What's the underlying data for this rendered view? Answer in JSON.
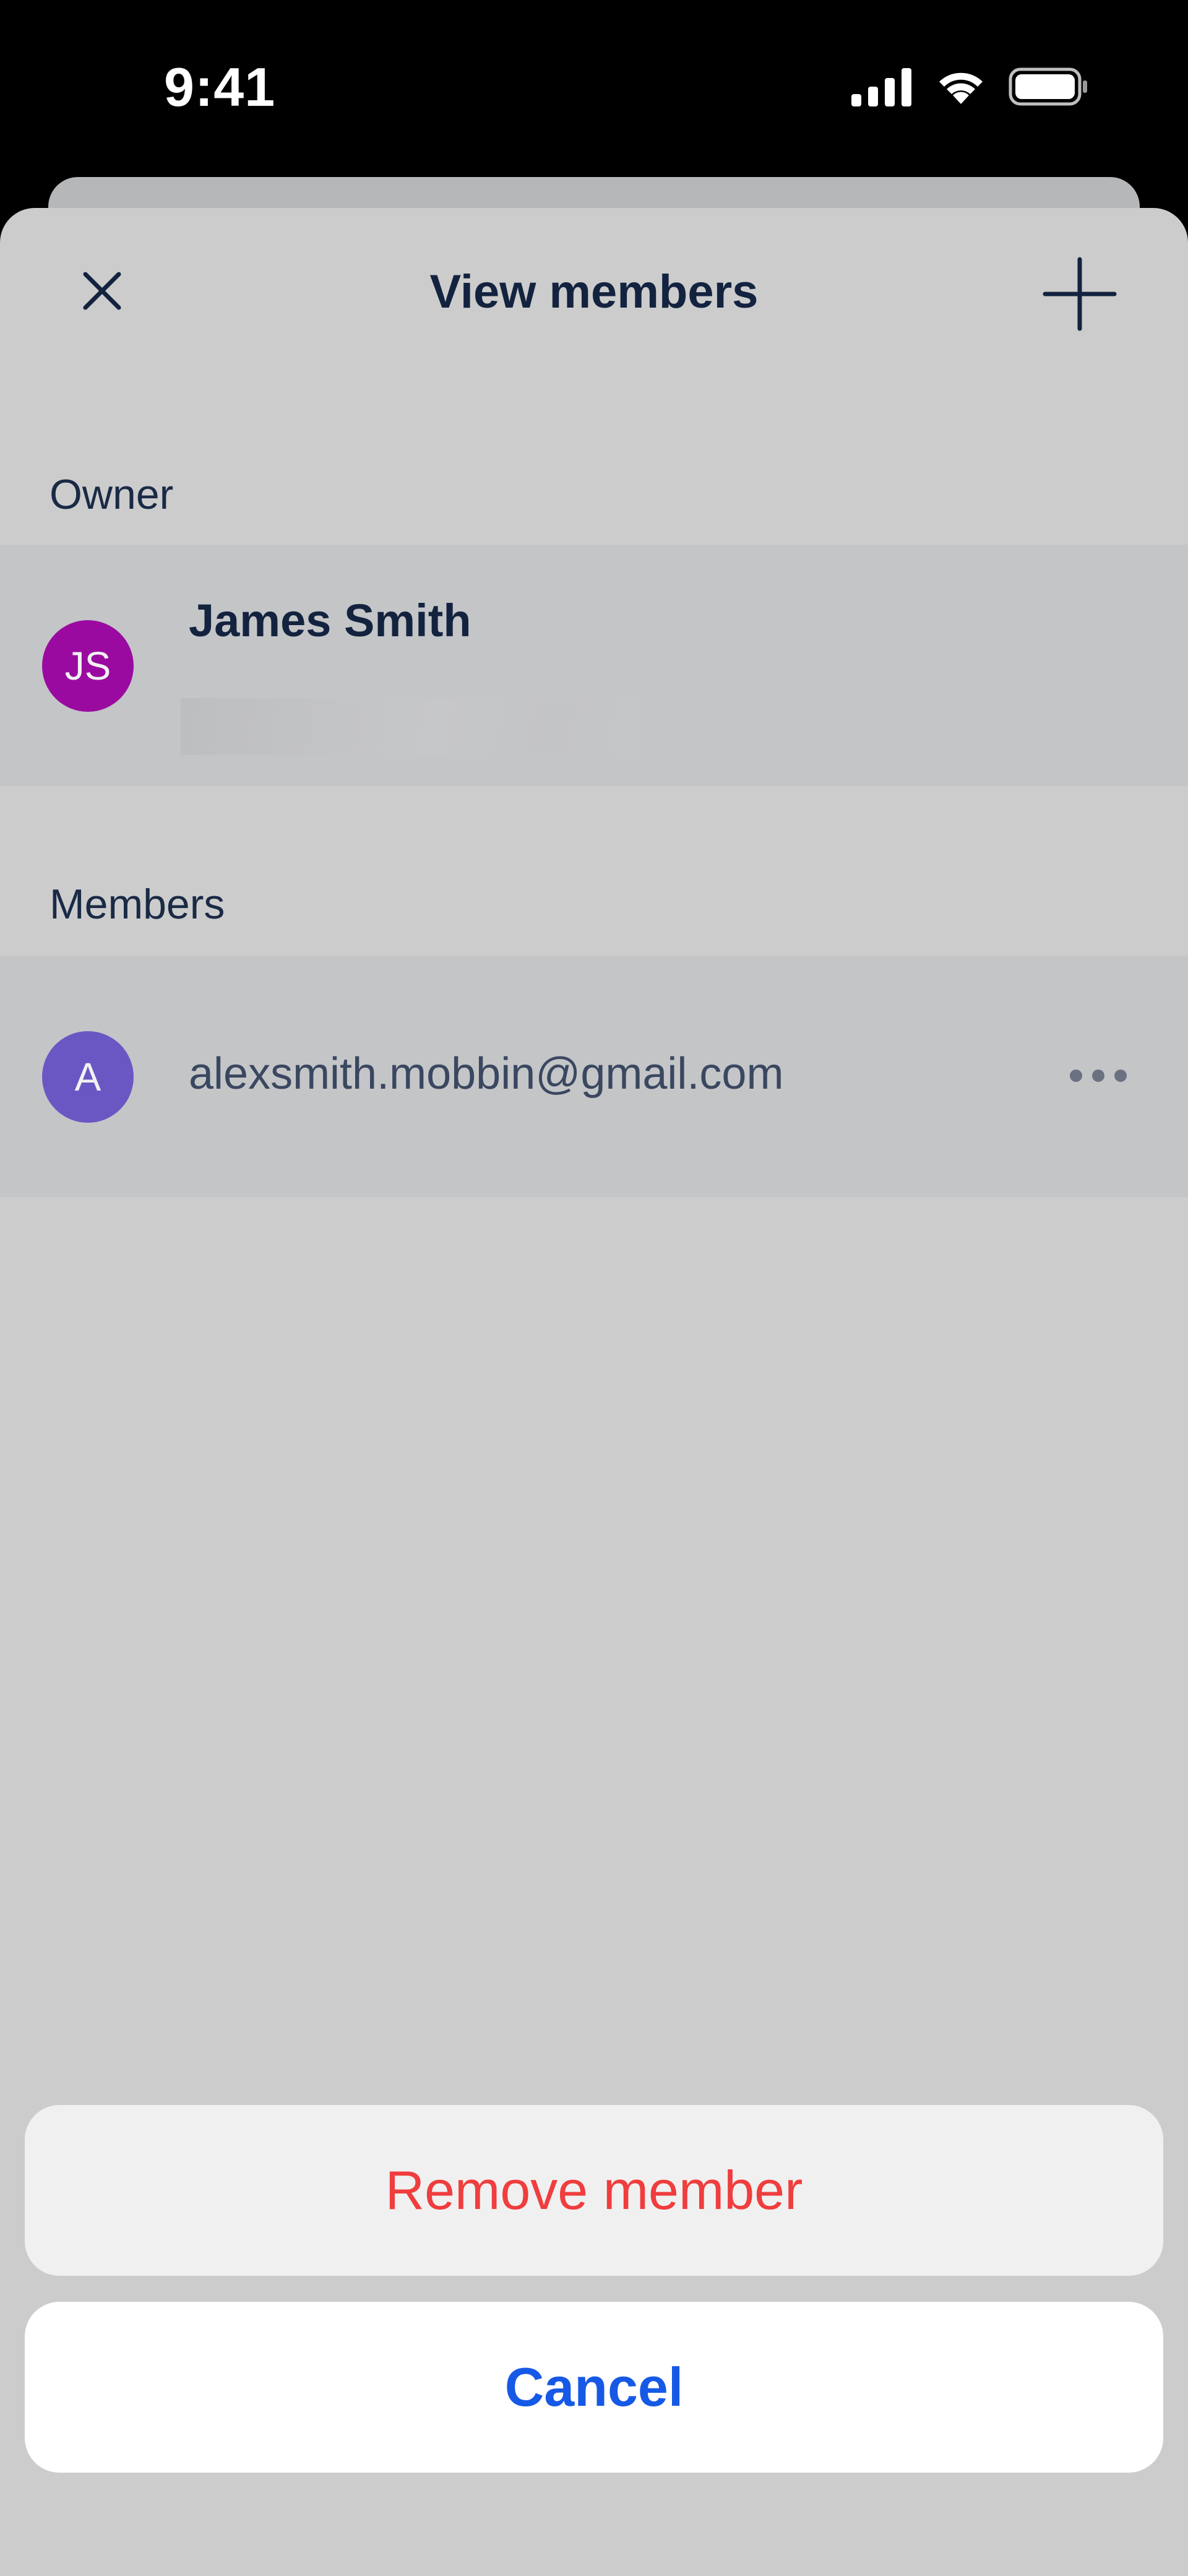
{
  "status_bar": {
    "time": "9:41",
    "icons": [
      "cellular-signal-icon",
      "wifi-icon",
      "battery-icon"
    ]
  },
  "header": {
    "title": "View members",
    "close_icon": "close-icon",
    "add_icon": "plus-icon"
  },
  "owner_section": {
    "label": "Owner",
    "owner": {
      "initials": "JS",
      "name": "James Smith",
      "avatar_color": "#9a0aa0"
    }
  },
  "members_section": {
    "label": "Members",
    "members": [
      {
        "initial": "A",
        "email": "alexsmith.mobbin@gmail.com",
        "avatar_color": "#6a57c4",
        "more_icon": "more-horizontal-icon"
      }
    ]
  },
  "action_sheet": {
    "remove_label": "Remove member",
    "cancel_label": "Cancel",
    "destructive_color": "#f03d3d",
    "accent_color": "#1659e6"
  }
}
